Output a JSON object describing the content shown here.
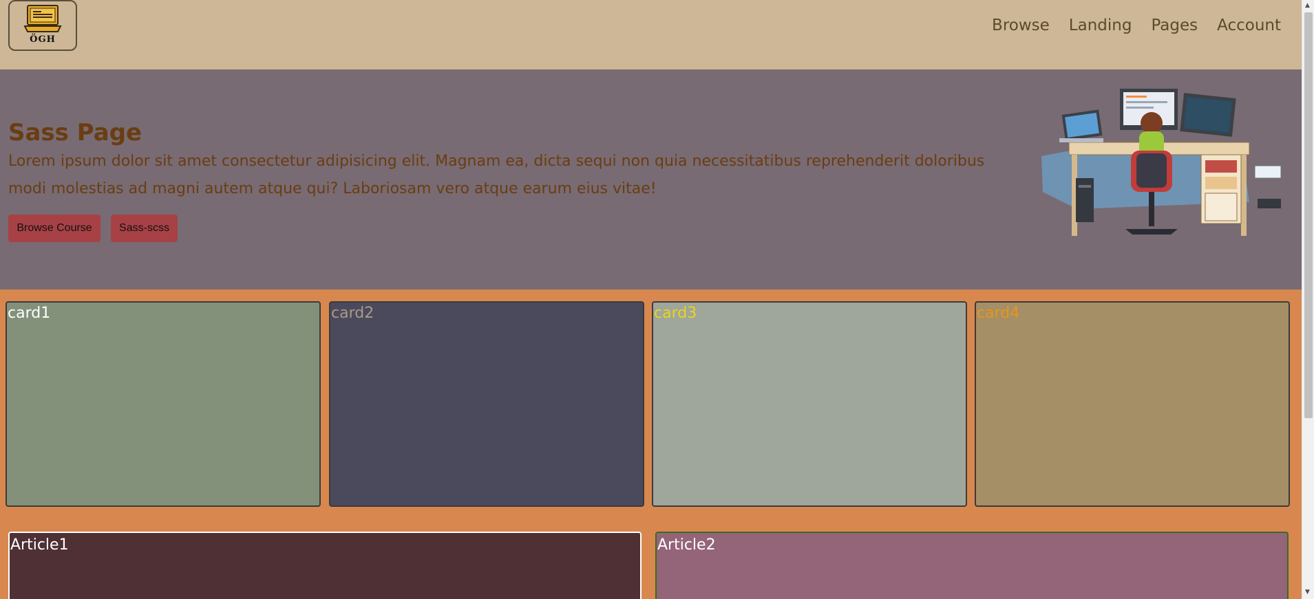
{
  "header": {
    "logo_text": "ÖGH",
    "nav": [
      "Browse",
      "Landing",
      "Pages",
      "Account"
    ]
  },
  "hero": {
    "title": "Sass Page",
    "text": "Lorem ipsum dolor sit amet consectetur adipisicing elit. Magnam ea, dicta sequi non quia necessitatibus reprehenderit doloribus modi molestias ad magni autem atque qui? Laboriosam vero atque earum eius vitae!",
    "buttons": [
      "Browse Course",
      "Sass-scss"
    ]
  },
  "cards": [
    {
      "label": "card1",
      "color": "#83917a",
      "text_color": "#ffffff"
    },
    {
      "label": "card2",
      "color": "#4b4a5c",
      "text_color": "#a89a8c"
    },
    {
      "label": "card3",
      "color": "#9fa69c",
      "text_color": "#e8d51d"
    },
    {
      "label": "card4",
      "color": "#a58f66",
      "text_color": "#e8951d"
    }
  ],
  "articles": [
    {
      "label": "Article1"
    },
    {
      "label": "Article2"
    }
  ],
  "colors": {
    "header_bg": "#cdb796",
    "hero_bg": "#786b73",
    "page_bg": "#d8884f",
    "button_bg": "#a74145",
    "title_color": "#6a3d12"
  }
}
